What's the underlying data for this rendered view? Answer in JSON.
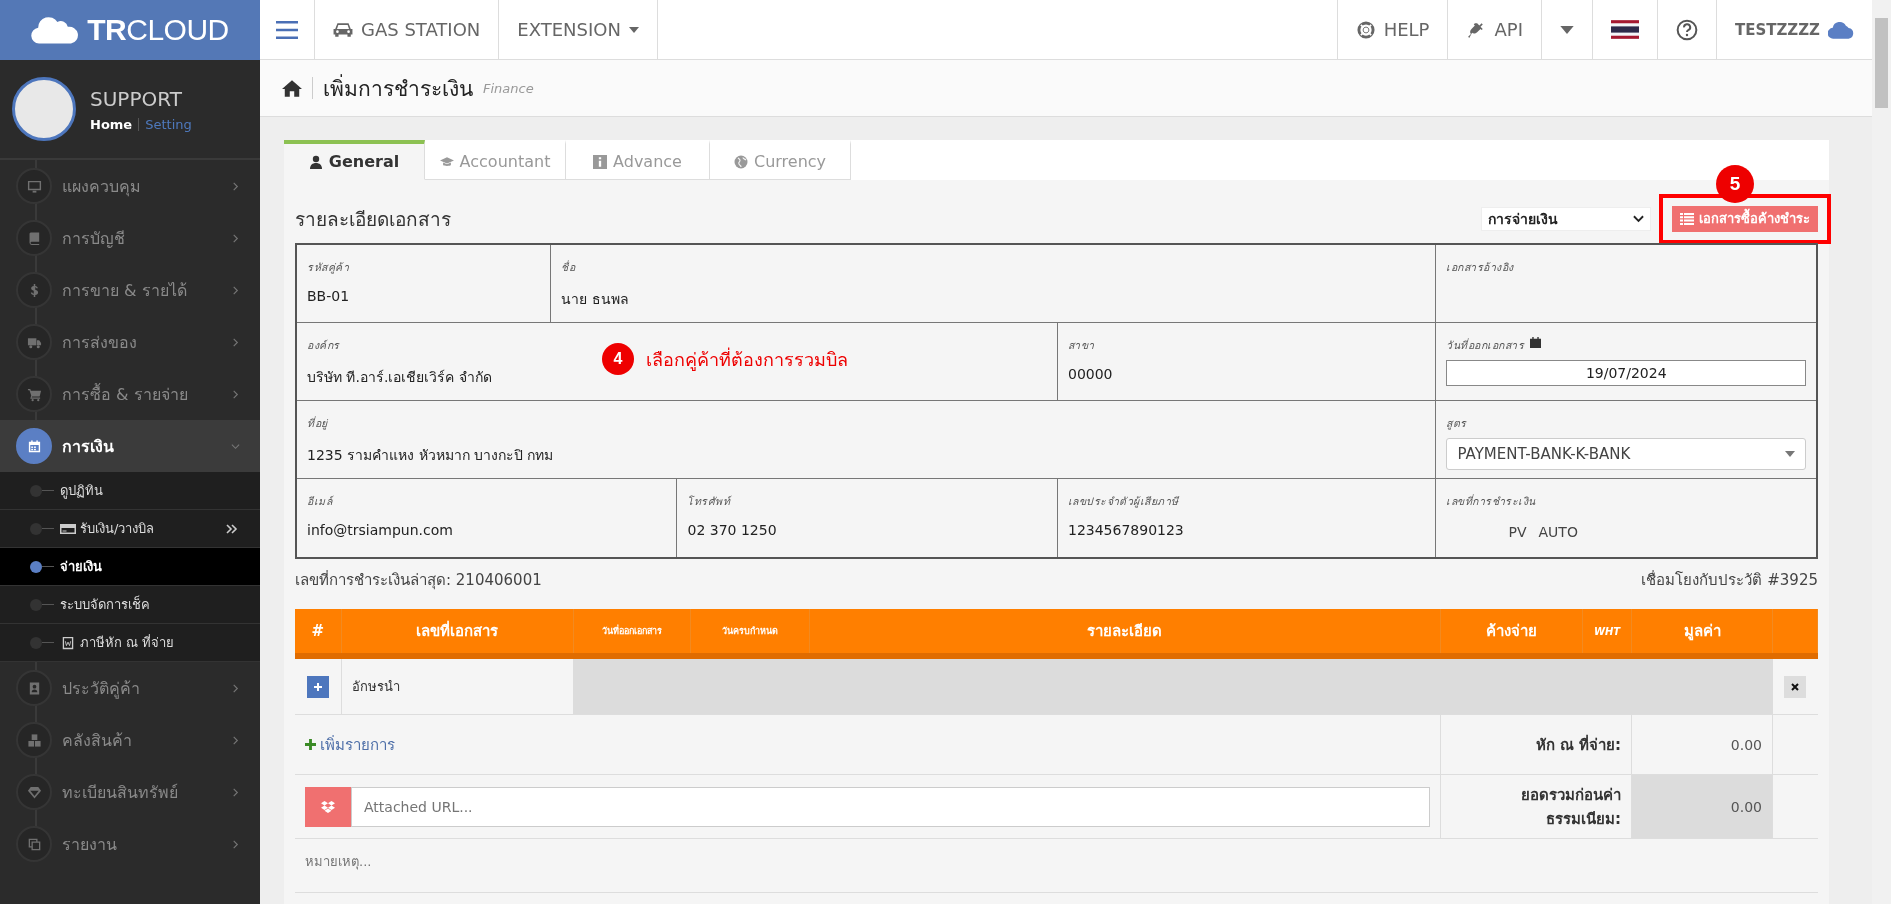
{
  "brand": {
    "bold": "TR",
    "light": "CLOUD"
  },
  "profile": {
    "name": "SUPPORT",
    "links": [
      {
        "label": "Home",
        "selected": true
      },
      {
        "label": "Setting",
        "selected": false
      }
    ]
  },
  "sidebar": {
    "items": [
      {
        "label": "แผงควบคุม",
        "selected": false,
        "expanded": false
      },
      {
        "label": "การบัญชี",
        "selected": false,
        "expanded": false
      },
      {
        "label": "การขาย & รายได้",
        "selected": false,
        "expanded": false
      },
      {
        "label": "การส่งของ",
        "selected": false,
        "expanded": false
      },
      {
        "label": "การซื้อ & รายจ่าย",
        "selected": false,
        "expanded": false
      },
      {
        "label": "การเงิน",
        "selected": true,
        "expanded": true,
        "children": [
          {
            "label": "ดูปฏิทิน",
            "selected": false
          },
          {
            "label": "รับเงิน/วางบิล",
            "selected": false
          },
          {
            "label": "จ่ายเงิน",
            "selected": true
          },
          {
            "label": "ระบบจัดการเช็ค",
            "selected": false
          },
          {
            "label": "ภาษีหัก ณ ที่จ่าย",
            "selected": false
          }
        ]
      },
      {
        "label": "ประวัติคู่ค้า",
        "selected": false,
        "expanded": false
      },
      {
        "label": "คลังสินค้า",
        "selected": false,
        "expanded": false
      },
      {
        "label": "ทะเบียนสินทรัพย์",
        "selected": false,
        "expanded": false
      },
      {
        "label": "รายงาน",
        "selected": false,
        "expanded": false
      }
    ]
  },
  "topbar": {
    "left": [
      {
        "kind": "link",
        "label": "GAS STATION"
      },
      {
        "kind": "dropdown",
        "label": "EXTENSION"
      }
    ],
    "right": [
      {
        "kind": "link",
        "label": "HELP"
      },
      {
        "kind": "link",
        "label": "API"
      },
      {
        "kind": "dropdown"
      },
      {
        "kind": "flag"
      },
      {
        "kind": "help"
      },
      {
        "kind": "user",
        "label": "TESTZZZZ"
      }
    ]
  },
  "page": {
    "title": "เพิ่มการชำระเงิน",
    "subtitle": "Finance"
  },
  "tabs": [
    {
      "label": "General",
      "selected": true
    },
    {
      "label": "Accountant",
      "selected": false
    },
    {
      "label": "Advance",
      "selected": false
    },
    {
      "label": "Currency",
      "selected": false
    }
  ],
  "form": {
    "title": "รายละเอียดเอกสาร",
    "doc_type": "การจ่ายเงิน",
    "button": "เอกสารซื้อค้างชำระ",
    "fields": [
      {
        "kind": "text",
        "label": "รหัสคู่ค้า",
        "value": "BB-01"
      },
      {
        "kind": "text",
        "label": "ชื่อ",
        "value": "นาย ธนพล"
      },
      {
        "kind": "text",
        "label": "เอกสารอ้างอิง"
      },
      {
        "kind": "text",
        "label": "องค์กร",
        "value": "บริษัท ที.อาร์.เอเชียเวิร์ค จำกัด"
      },
      {
        "kind": "text",
        "label": "สาขา",
        "value": "00000"
      },
      {
        "kind": "date",
        "label": "วันที่ออกเอกสาร",
        "value": "19/07/2024"
      },
      {
        "kind": "text",
        "label": "ที่อยู่",
        "value": "1235 รามคำแหง หัวหมาก บางกะปิ กทม"
      },
      {
        "kind": "select",
        "label": "สูตร",
        "value": "PAYMENT-BANK-K-BANK"
      },
      {
        "kind": "text",
        "label": "อีเมล์",
        "value": "info@trsiampun.com"
      },
      {
        "kind": "text",
        "label": "โทรศัพท์",
        "value": "02 370 1250"
      },
      {
        "kind": "text",
        "label": "เลขประจำตัวผู้เสียภาษี",
        "value": "1234567890123"
      },
      {
        "kind": "code",
        "label": "เลขที่การชำระเงิน",
        "prefix": "PV",
        "value": "AUTO"
      }
    ],
    "last_number": "เลขที่การชำระเงินล่าสุด: 210406001",
    "history_link": "เชื่อมโยงกับประวัติ #3925"
  },
  "annotations": [
    {
      "number": "5"
    },
    {
      "number": "4",
      "text": "เลือกคู่ค้าที่ต้องการรวมบิล"
    }
  ],
  "table": {
    "columns": [
      {
        "label": "#",
        "kind": "normal"
      },
      {
        "label": "เลขที่เอกสาร",
        "kind": "normal"
      },
      {
        "label": "วันที่ออกเอกสาร",
        "kind": "small"
      },
      {
        "label": "วันครบกำหนด",
        "kind": "small"
      },
      {
        "label": "รายละเอียด",
        "kind": "normal"
      },
      {
        "label": "ค้างจ่าย",
        "kind": "normal"
      },
      {
        "label": "WHT",
        "kind": "small"
      },
      {
        "label": "มูลค่า",
        "kind": "normal"
      }
    ],
    "rows": [
      {
        "label": "อักษรนำ"
      }
    ],
    "add_item": "เพิ่มรายการ",
    "wht": {
      "label": "หัก ณ ที่จ่าย:",
      "value": "0.00"
    },
    "attachment": {
      "placeholder": "Attached URL..."
    },
    "subtotal": {
      "label": "ยอดรวมก่อนค่าธรรมเนียม:",
      "value": "0.00"
    },
    "note": {
      "placeholder": "หมายเหตุ..."
    }
  }
}
